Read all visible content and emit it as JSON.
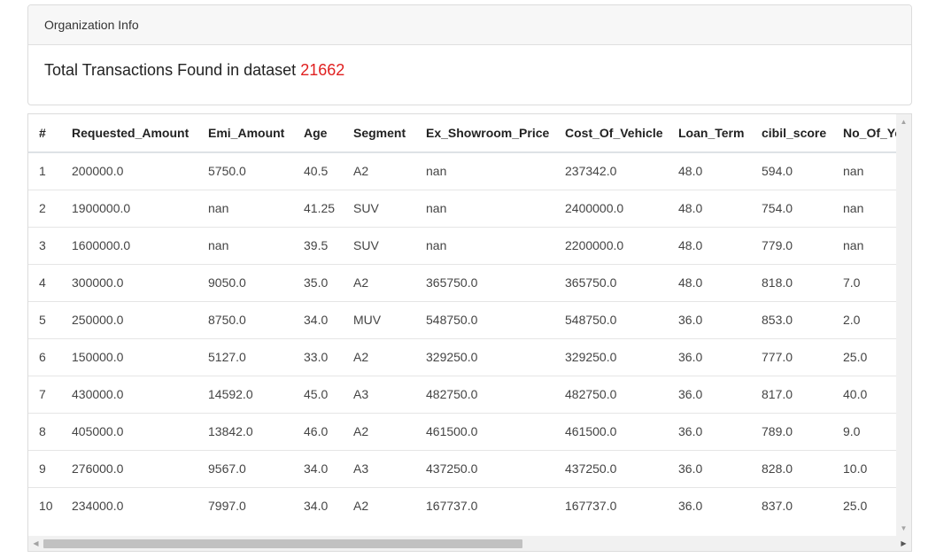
{
  "card": {
    "header": "Organization Info",
    "summary_label": "Total Transactions Found in dataset",
    "summary_count": "21662"
  },
  "table": {
    "columns": [
      "#",
      "Requested_Amount",
      "Emi_Amount",
      "Age",
      "Segment",
      "Ex_Showroom_Price",
      "Cost_Of_Vehicle",
      "Loan_Term",
      "cibil_score",
      "No_Of_Ye"
    ],
    "rows": [
      [
        "1",
        "200000.0",
        "5750.0",
        "40.5",
        "A2",
        "nan",
        "237342.0",
        "48.0",
        "594.0",
        "nan"
      ],
      [
        "2",
        "1900000.0",
        "nan",
        "41.25",
        "SUV",
        "nan",
        "2400000.0",
        "48.0",
        "754.0",
        "nan"
      ],
      [
        "3",
        "1600000.0",
        "nan",
        "39.5",
        "SUV",
        "nan",
        "2200000.0",
        "48.0",
        "779.0",
        "nan"
      ],
      [
        "4",
        "300000.0",
        "9050.0",
        "35.0",
        "A2",
        "365750.0",
        "365750.0",
        "48.0",
        "818.0",
        "7.0"
      ],
      [
        "5",
        "250000.0",
        "8750.0",
        "34.0",
        "MUV",
        "548750.0",
        "548750.0",
        "36.0",
        "853.0",
        "2.0"
      ],
      [
        "6",
        "150000.0",
        "5127.0",
        "33.0",
        "A2",
        "329250.0",
        "329250.0",
        "36.0",
        "777.0",
        "25.0"
      ],
      [
        "7",
        "430000.0",
        "14592.0",
        "45.0",
        "A3",
        "482750.0",
        "482750.0",
        "36.0",
        "817.0",
        "40.0"
      ],
      [
        "8",
        "405000.0",
        "13842.0",
        "46.0",
        "A2",
        "461500.0",
        "461500.0",
        "36.0",
        "789.0",
        "9.0"
      ],
      [
        "9",
        "276000.0",
        "9567.0",
        "34.0",
        "A3",
        "437250.0",
        "437250.0",
        "36.0",
        "828.0",
        "10.0"
      ],
      [
        "10",
        "234000.0",
        "7997.0",
        "34.0",
        "A2",
        "167737.0",
        "167737.0",
        "36.0",
        "837.0",
        "25.0"
      ]
    ]
  },
  "scrollbars": {
    "up_icon": "▲",
    "down_icon": "▼",
    "left_icon": "◀",
    "right_icon": "▶"
  }
}
